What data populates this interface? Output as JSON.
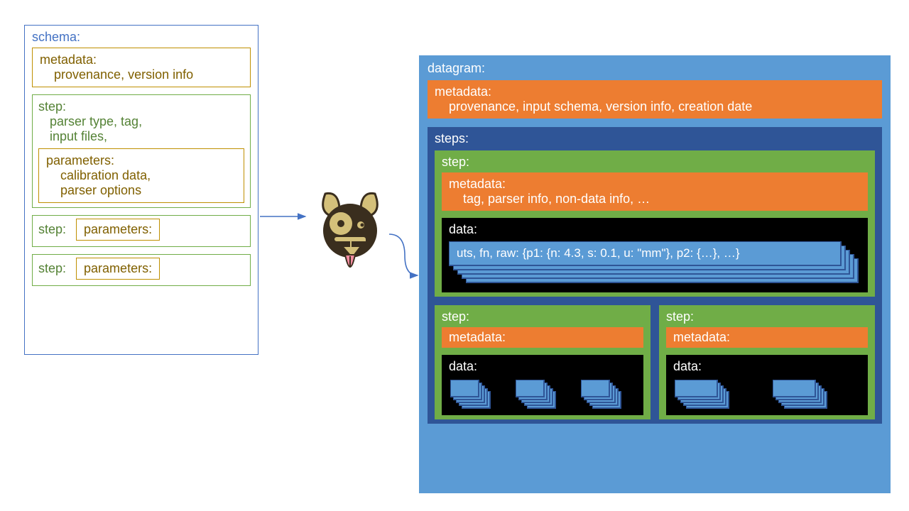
{
  "schema": {
    "title": "schema:",
    "metadata_label": "metadata:",
    "metadata_body": "provenance, version info",
    "step1": {
      "label": "step:",
      "body_l1": "parser type, tag,",
      "body_l2": "input files,",
      "parameters_label": "parameters:",
      "parameters_l1": "calibration data,",
      "parameters_l2": "parser options"
    },
    "mini_step_label": "step:",
    "mini_param_label": "parameters:"
  },
  "datagram": {
    "title": "datagram:",
    "metadata_label": "metadata:",
    "metadata_body": "provenance, input schema, version info, creation date",
    "steps_label": "steps:",
    "step_label": "step:",
    "step_meta_label": "metadata:",
    "step_meta_body": "tag, parser info, non-data info, …",
    "data_label": "data:",
    "record_text": "uts, fn, raw: {p1: {n: 4.3, s: 0.1, u: \"mm\"}, p2: {…}, …}",
    "small_meta_label": "metadata:",
    "small_data_label": "data:"
  }
}
